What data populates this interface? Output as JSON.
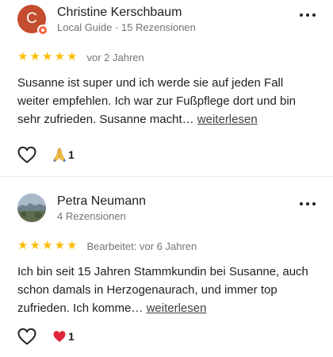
{
  "reviews": [
    {
      "avatar_letter": "C",
      "name": "Christine Kerschbaum",
      "subtitle": "Local Guide · 15 Rezensionen",
      "stars": 5,
      "date": "vor 2 Jahren",
      "text": "Susanne ist super und ich werde sie auf jeden Fall weiter empfehlen. Ich war zur Fußpflege dort und bin sehr zufrieden. Susanne macht…",
      "more_link": "weiterlesen",
      "reaction_icon": "folded-hands-icon",
      "reaction_count": "1"
    },
    {
      "name": "Petra Neumann",
      "subtitle": "4 Rezensionen",
      "stars": 5,
      "date": "Bearbeitet: vor 6 Jahren",
      "text": "Ich bin seit 15 Jahren Stammkundin bei Susanne, auch schon damals in Herzogenaurach, und immer top zufrieden. Ich komme…",
      "more_link": "weiterlesen",
      "reaction_icon": "red-heart-icon",
      "reaction_count": "1"
    }
  ],
  "colors": {
    "star": "#fbbc04",
    "avatar_bg": "#c44d2f",
    "guide_badge": "#f2643a",
    "secondary_text": "#70757a",
    "divider": "#e8eaed"
  }
}
